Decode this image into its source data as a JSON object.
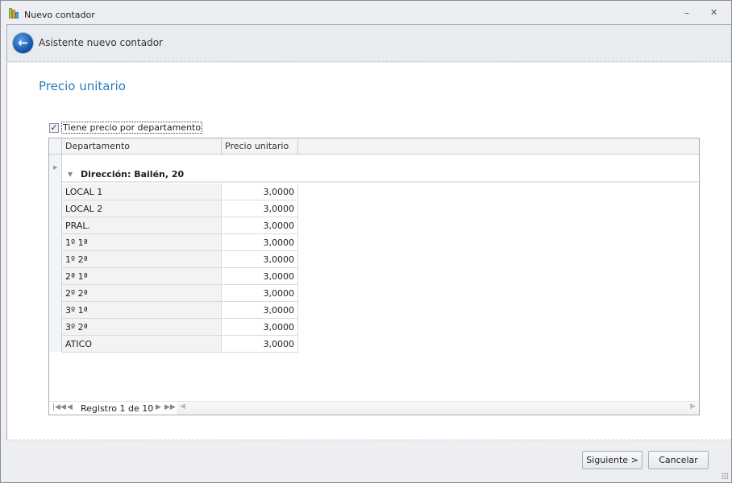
{
  "window": {
    "title": "Nuevo contador",
    "minimize": "–",
    "close": "✕"
  },
  "header": {
    "title": "Asistente nuevo contador"
  },
  "page": {
    "title": "Precio unitario"
  },
  "checkbox": {
    "label": "Tiene precio por departamento",
    "checked": true,
    "mark": "✓"
  },
  "grid": {
    "columns": [
      "Departamento",
      "Precio unitario"
    ],
    "group": {
      "label": "Dirección: Bailén, 20"
    },
    "rows": [
      {
        "dept": "LOCAL 1",
        "price": "3,0000"
      },
      {
        "dept": "LOCAL 2",
        "price": "3,0000"
      },
      {
        "dept": "PRAL.",
        "price": "3,0000"
      },
      {
        "dept": "1º 1ª",
        "price": "3,0000"
      },
      {
        "dept": "1º 2ª",
        "price": "3,0000"
      },
      {
        "dept": "2ª 1ª",
        "price": "3,0000"
      },
      {
        "dept": "2º 2ª",
        "price": "3,0000"
      },
      {
        "dept": "3º 1ª",
        "price": "3,0000"
      },
      {
        "dept": "3º 2ª",
        "price": "3,0000"
      },
      {
        "dept": "ATICO",
        "price": "3,0000"
      }
    ],
    "pager": {
      "text": "Registro 1 de 10"
    }
  },
  "buttons": {
    "next": "Siguiente >",
    "cancel": "Cancelar"
  }
}
